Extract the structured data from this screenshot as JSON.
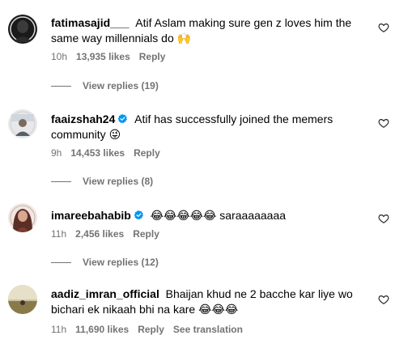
{
  "comments": [
    {
      "username": "fatimasajid___",
      "verified": false,
      "text": "Atif Aslam making sure gen z loves him the same way millennials do",
      "emoji": "🙌",
      "time": "10h",
      "likes": "13,935 likes",
      "reply": "Reply",
      "view_replies": "View replies (19)"
    },
    {
      "username": "faaizshah24",
      "verified": true,
      "text": "Atif has successfully joined the memers community",
      "emoji": "😜",
      "time": "9h",
      "likes": "14,453 likes",
      "reply": "Reply",
      "view_replies": "View replies (8)"
    },
    {
      "username": "imareebahabib",
      "verified": true,
      "text": "saraaaaaaaa",
      "emoji": "😂😂😂😂😂",
      "time": "11h",
      "likes": "2,456 likes",
      "reply": "Reply",
      "view_replies": "View replies (12)"
    },
    {
      "username": "aadiz_imran_official",
      "verified": false,
      "text": "Bhaijan khud ne 2 bacche kar liye wo bichari ek nikaah bhi na kare",
      "emoji": "😂😂😂",
      "time": "11h",
      "likes": "11,690 likes",
      "reply": "Reply",
      "see_translation": "See translation"
    }
  ],
  "colors": {
    "meta_gray": "#737373",
    "verified_blue": "#0095f6"
  },
  "icons": {
    "like": "heart-outline-icon",
    "verified": "verified-badge-icon"
  }
}
